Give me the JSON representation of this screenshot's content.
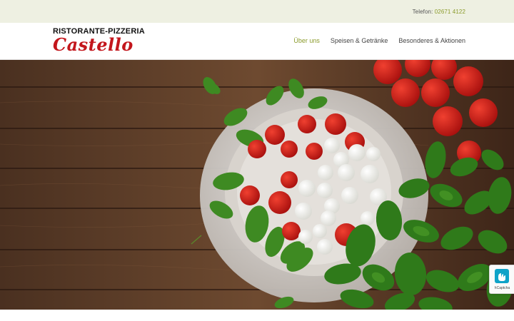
{
  "topbar": {
    "phone_label": "Telefon:",
    "phone_number": "02671 4122"
  },
  "logo": {
    "line1": "RISTORANTE-PIZZERIA",
    "line2": "Castello"
  },
  "nav": {
    "items": [
      {
        "label": "Über uns",
        "active": true
      },
      {
        "label": "Speisen & Getränke",
        "active": false
      },
      {
        "label": "Besonderes & Aktionen",
        "active": false
      }
    ]
  },
  "hero": {
    "image": "caprese-on-wooden-table"
  },
  "captcha": {
    "label": "hCaptcha",
    "icon": "hcaptcha-icon"
  },
  "colors": {
    "accent": "#8a9a2a",
    "brand_red": "#c3161c",
    "topbar_bg": "#eef0e2"
  }
}
